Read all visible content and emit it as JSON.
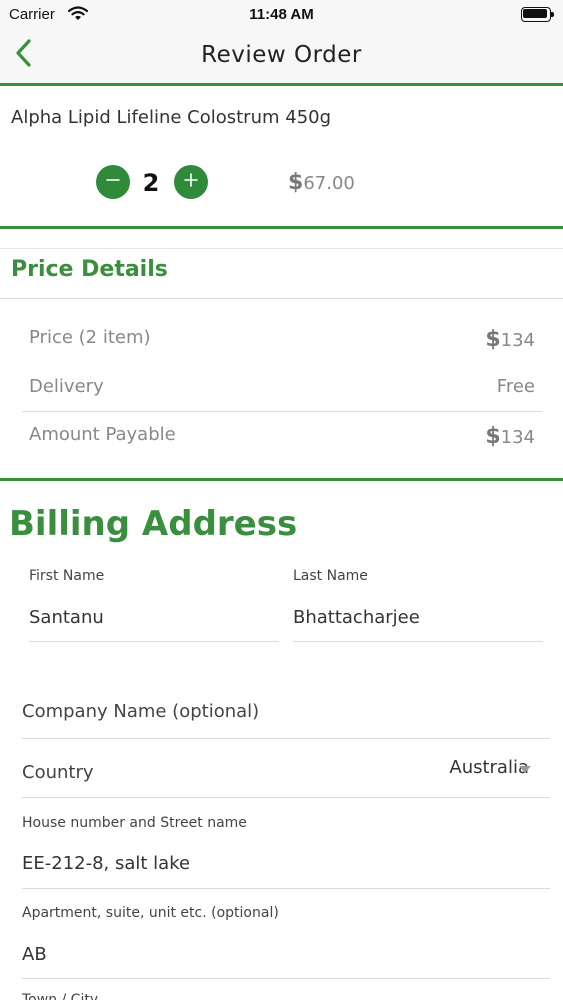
{
  "status_bar": {
    "carrier": "Carrier",
    "time": "11:48 AM"
  },
  "nav": {
    "title": "Review Order",
    "back_icon": "chevron-left-icon"
  },
  "product": {
    "name": "Alpha Lipid Lifeline Colostrum 450g",
    "quantity": "2",
    "price_symbol": "$",
    "price_amount": "67.00"
  },
  "price_details": {
    "heading": "Price Details",
    "rows": [
      {
        "label": "Price (2 item)",
        "symbol": "$",
        "value": "134"
      },
      {
        "label": "Delivery",
        "symbol": "",
        "value": "Free"
      },
      {
        "label": "Amount Payable",
        "symbol": "$",
        "value": "134"
      }
    ]
  },
  "billing": {
    "title": "Billing Address",
    "first_name": {
      "label": "First Name",
      "value": "Santanu"
    },
    "last_name": {
      "label": "Last Name",
      "value": "Bhattacharjee"
    },
    "company": {
      "placeholder": "Company Name (optional)"
    },
    "country": {
      "label": "Country",
      "value": "Australia"
    },
    "street": {
      "label": "House number and Street name",
      "value": "EE-212-8, salt lake"
    },
    "apartment": {
      "label": "Apartment, suite, unit etc. (optional)",
      "value": "AB"
    },
    "town": {
      "label": "Town / City"
    }
  },
  "colors": {
    "accent": "#3a8f3f",
    "button": "#2f8a3a"
  }
}
